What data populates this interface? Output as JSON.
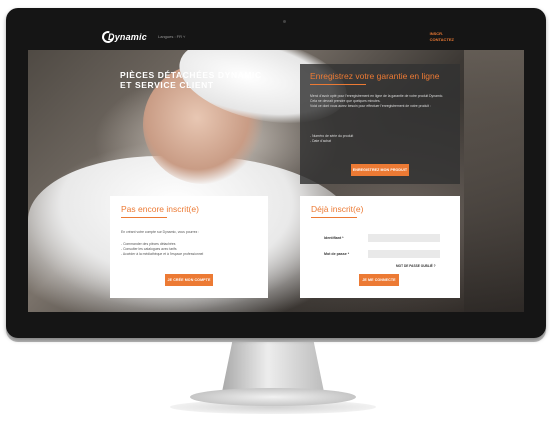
{
  "nav": {
    "brand": "Dynamic",
    "lang_label": "Langues : FR ˅",
    "links": [
      "INSCR.",
      "CONTACTEZ"
    ]
  },
  "hero": {
    "title_line1": "PIÈCES DÉTACHÉES DYNAMIC",
    "title_line2": "ET SERVICE CLIENT"
  },
  "guarantee": {
    "title": "Enregistrez votre garantie en ligne",
    "body_lines": [
      "Merci d'avoir opté pour l'enregistrement en ligne de la garantie de votre produit Dynamic.",
      "Cela ne devrait prendre que quelques minutes.",
      "Voici ce dont vous aurez besoin pour effectuer l'enregistrement de votre produit :"
    ],
    "list": [
      "- Numéro de série du produit",
      "- Date d'achat"
    ],
    "button": "ENREGISTREZ MON PRODUIT"
  },
  "signup": {
    "title": "Pas encore inscrit(e)",
    "intro": "En créant votre compte sur Dynamic, vous pourrez :",
    "items": [
      "- Commander des pièces détachées",
      "- Consulter les catalogues avec tarifs",
      "- Accéder à la médiathèque et à l'espace professionnel"
    ],
    "button": "JE CRÉE MON COMPTE"
  },
  "login": {
    "title": "Déjà inscrit(e)",
    "identifier_label": "Identifiant *",
    "password_label": "Mot de passe *",
    "forgot": "MOT DE PASSE OUBLIÉ ?",
    "button": "JE ME CONNECTE"
  },
  "colors": {
    "accent": "#ec7a34",
    "navbar": "#151515"
  }
}
